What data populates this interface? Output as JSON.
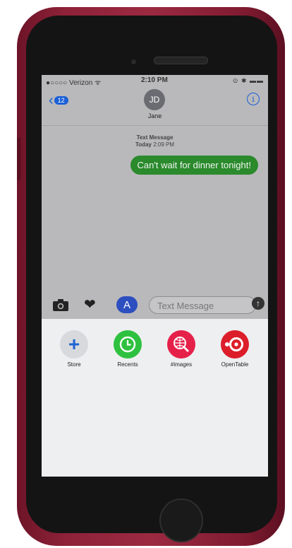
{
  "status": {
    "carrier": "●○○○○ Verizon ᯤ",
    "time": "2:10 PM",
    "battery": "⊙ ✱ ▬▬"
  },
  "nav": {
    "back_count": "12",
    "avatar_initials": "JD",
    "contact_name": "Jane"
  },
  "thread": {
    "service": "Text Message",
    "day": "Today",
    "time": "2:09 PM",
    "message": "Can't wait for dinner tonight!"
  },
  "compose": {
    "placeholder": "Text Message"
  },
  "apps": [
    {
      "label": "Store"
    },
    {
      "label": "Recents"
    },
    {
      "label": "#images"
    },
    {
      "label": "OpenTable"
    }
  ],
  "colors": {
    "imessage_blue": "#1a5fd6",
    "sms_green": "#2a8a2c",
    "case_red": "#8e2238"
  }
}
